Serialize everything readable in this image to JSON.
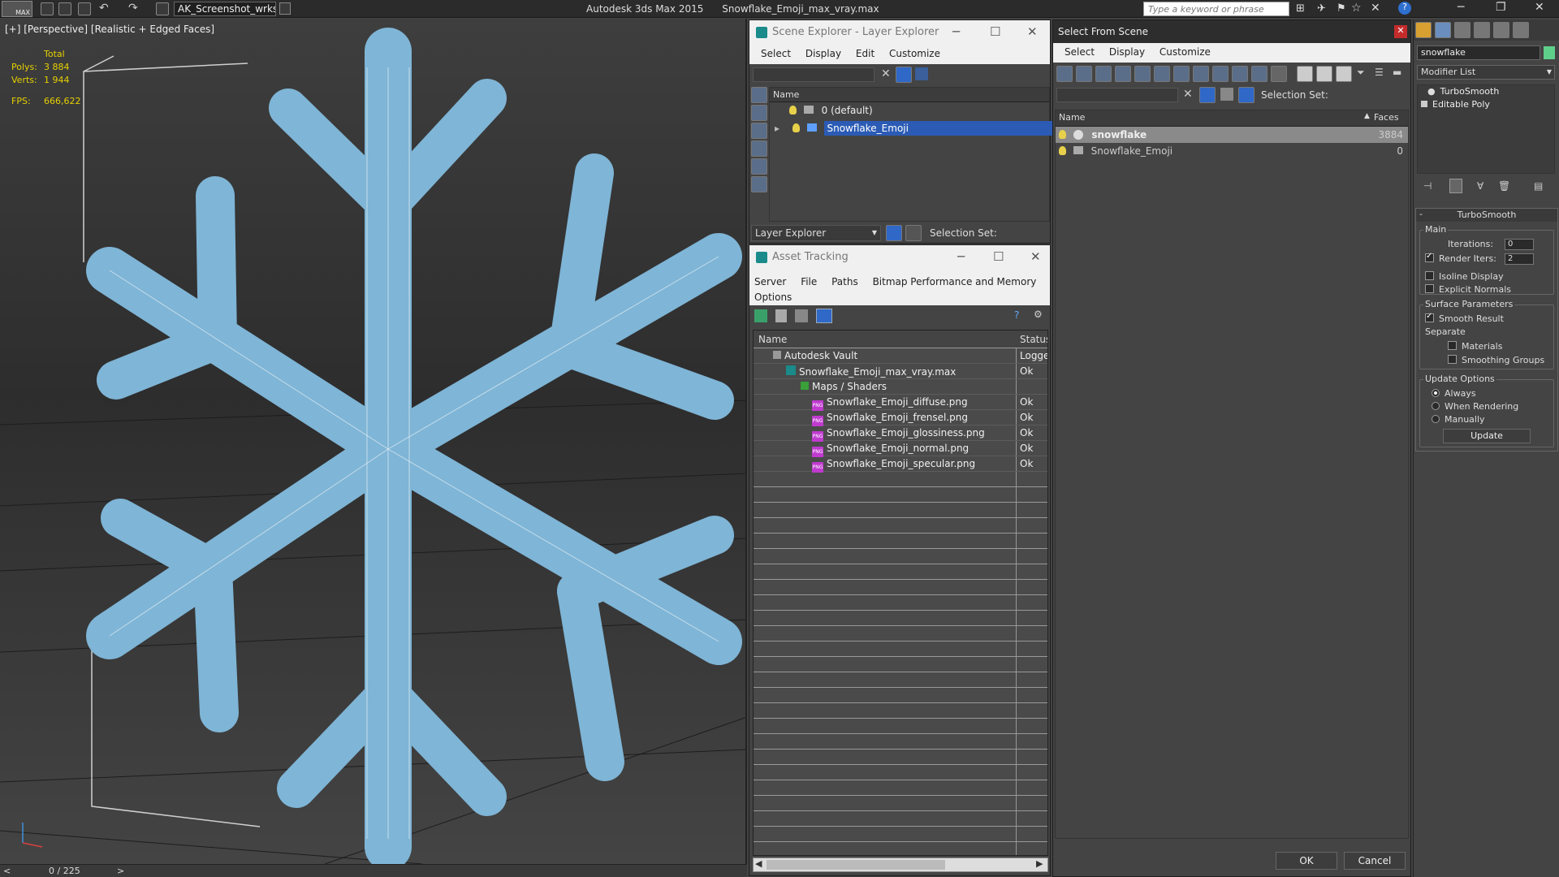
{
  "app": {
    "logo": "MAX",
    "workspace": "AK_Screenshot_wrksp",
    "title_app": "Autodesk 3ds Max  2015",
    "title_file": "Snowflake_Emoji_max_vray.max",
    "search_placeholder": "Type a keyword or phrase"
  },
  "viewport": {
    "label": "[+] [Perspective] [Realistic + Edged Faces]",
    "stats": {
      "total_label": "Total",
      "polys_label": "Polys:",
      "polys_value": "3 884",
      "verts_label": "Verts:",
      "verts_value": "1 944",
      "fps_label": "FPS:",
      "fps_value": "666,622"
    },
    "model_color": "#7fb5d6"
  },
  "timeline": {
    "frame": "0 / 225",
    "prev": "<",
    "next": ">"
  },
  "scene_explorer": {
    "title": "Scene Explorer - Layer Explorer",
    "menu": [
      "Select",
      "Display",
      "Edit",
      "Customize"
    ],
    "col_name": "Name",
    "rows": [
      "0 (default)",
      "Snowflake_Emoji"
    ],
    "footer_label": "Layer Explorer",
    "selection_set": "Selection Set:"
  },
  "asset_tracking": {
    "title": "Asset Tracking",
    "menu": [
      "Server",
      "File",
      "Paths",
      "Bitmap Performance and Memory",
      "Options"
    ],
    "col_name": "Name",
    "col_status": "Status",
    "rows": [
      {
        "name": "Autodesk Vault",
        "status": "Logged"
      },
      {
        "name": "Snowflake_Emoji_max_vray.max",
        "status": "Ok"
      },
      {
        "name": "Maps / Shaders",
        "status": ""
      },
      {
        "name": "Snowflake_Emoji_diffuse.png",
        "status": "Ok"
      },
      {
        "name": "Snowflake_Emoji_frensel.png",
        "status": "Ok"
      },
      {
        "name": "Snowflake_Emoji_glossiness.png",
        "status": "Ok"
      },
      {
        "name": "Snowflake_Emoji_normal.png",
        "status": "Ok"
      },
      {
        "name": "Snowflake_Emoji_specular.png",
        "status": "Ok"
      }
    ]
  },
  "select_from_scene": {
    "title": "Select From Scene",
    "menu": [
      "Select",
      "Display",
      "Customize"
    ],
    "selection_set": "Selection Set:",
    "col_name": "Name",
    "col_faces": "Faces",
    "rows": [
      {
        "name": "snowflake",
        "faces": "3884"
      },
      {
        "name": "Snowflake_Emoji",
        "faces": "0"
      }
    ],
    "ok": "OK",
    "cancel": "Cancel"
  },
  "command_panel": {
    "object_name": "snowflake",
    "modifier_list": "Modifier List",
    "stack": [
      "TurboSmooth",
      "Editable Poly"
    ],
    "rollout_title": "TurboSmooth",
    "main_group": "Main",
    "iterations_label": "Iterations:",
    "iterations_value": "0",
    "render_iters_label": "Render Iters:",
    "render_iters_value": "2",
    "isoline": "Isoline Display",
    "explicit_normals": "Explicit Normals",
    "surface_group": "Surface Parameters",
    "smooth_result": "Smooth Result",
    "separate": "Separate",
    "materials": "Materials",
    "smoothing_groups": "Smoothing Groups",
    "update_group": "Update Options",
    "always": "Always",
    "when_rendering": "When Rendering",
    "manually": "Manually",
    "update_btn": "Update"
  }
}
